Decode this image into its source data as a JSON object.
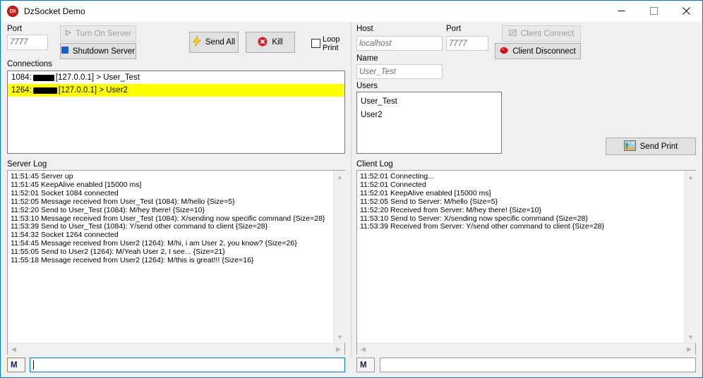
{
  "window": {
    "title": "DzSocket Demo",
    "icon": "dx-app-icon",
    "minimize": "minimize-icon",
    "maximize": "maximize-icon",
    "close": "close-icon",
    "accent_color": "#0078d7"
  },
  "server": {
    "port_label": "Port",
    "port_value": "7777",
    "turn_on_label": "Turn On Server",
    "turn_on_enabled": false,
    "shutdown_label": "Shutdown Server",
    "send_all_label": "Send All",
    "kill_label": "Kill",
    "loop_print_label_line1": "Loop",
    "loop_print_label_line2": "Print",
    "loop_print_checked": false,
    "connections_label": "Connections",
    "connections": [
      {
        "port": "1084:",
        "redacted": true,
        "ip": "[127.0.0.1]",
        "arrow": ">",
        "user": "User_Test",
        "selected": false
      },
      {
        "port": "1264:",
        "redacted": true,
        "ip": "[127.0.0.1]",
        "arrow": ">",
        "user": "User2",
        "selected": true
      }
    ],
    "log_label": "Server Log",
    "log_lines": [
      "11:51:45 Server up",
      "11:51:45 KeepAlive enabled [15000 ms]",
      "11:52:01 Socket 1084 connected",
      "11:52:05 Message received from User_Test (1084): M/hello {Size=5}",
      "11:52:20 Send to User_Test (1084): M/hey there! {Size=10}",
      "11:53:10 Message received from User_Test (1084): X/sending now specific command {Size=28}",
      "11:53:39 Send to User_Test (1084): Y/send other command to client {Size=28}",
      "11:54:32 Socket 1264 connected",
      "11:54:45 Message received from User2 (1264): M/hi, i am User 2, you know? {Size=26}",
      "11:55:05 Send to User2 (1264): M/Yeah User 2, I see... {Size=21}",
      "11:55:18 Message received from User2 (1264): M/this is great!!! {Size=16}"
    ],
    "msg_mode": "M",
    "msg_value": "",
    "msg_focused": true
  },
  "client": {
    "host_label": "Host",
    "host_value": "localhost",
    "port_label": "Port",
    "port_value": "7777",
    "name_label": "Name",
    "name_value": "User_Test",
    "connect_label": "Client Connect",
    "connect_enabled": false,
    "disconnect_label": "Client Disconnect",
    "users_label": "Users",
    "users": [
      "User_Test",
      "User2"
    ],
    "send_print_label": "Send Print",
    "log_label": "Client Log",
    "log_lines": [
      "11:52:01 Connecting...",
      "11:52:01 Connected",
      "11:52:01 KeepAlive enabled [15000 ms]",
      "11:52:05 Send to Server: M/hello {Size=5}",
      "11:52:20 Received from Server: M/hey there! {Size=10}",
      "11:53:10 Send to Server: X/sending now specific command {Size=28}",
      "11:53:39 Received from Server: Y/send other command to client {Size=28}"
    ],
    "msg_mode": "M",
    "msg_value": "",
    "msg_focused": false
  }
}
